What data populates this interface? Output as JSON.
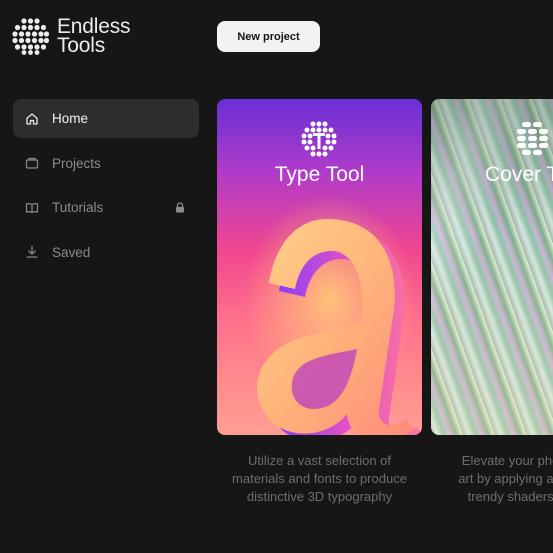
{
  "brand": {
    "line1": "Endless",
    "line2": "Tools"
  },
  "header": {
    "new_project_label": "New project"
  },
  "sidebar": {
    "items": [
      {
        "label": "Home",
        "icon": "home-icon",
        "active": true
      },
      {
        "label": "Projects",
        "icon": "folder-icon"
      },
      {
        "label": "Tutorials",
        "icon": "book-icon",
        "locked": true
      },
      {
        "label": "Saved",
        "icon": "download-icon"
      }
    ]
  },
  "cards": [
    {
      "title": "Type Tool",
      "icon": "type-tool-icon",
      "description": [
        "Utilize a vast selection of",
        "materials and fonts to produce",
        "distinctive 3D typography"
      ]
    },
    {
      "title": "Cover T",
      "icon": "cover-tool-icon",
      "description": [
        "Elevate your photo",
        "art by applying a div",
        "trendy shaders a"
      ]
    }
  ],
  "colors": {
    "background": "#161616",
    "sidebar_active": "#2d2d2d",
    "button_bg": "#f2f2f2"
  }
}
